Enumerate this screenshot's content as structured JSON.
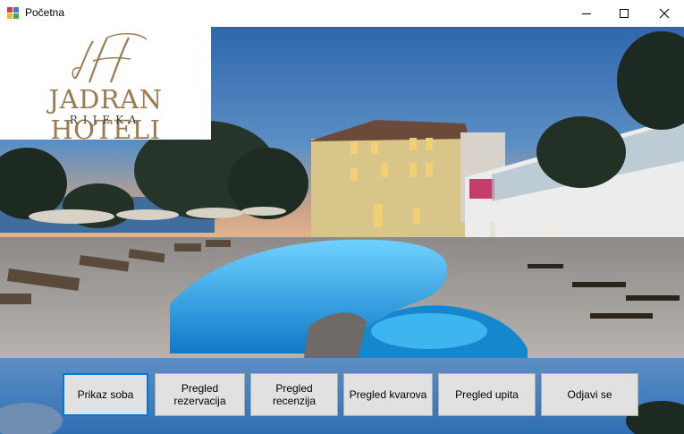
{
  "window": {
    "title": "Početna"
  },
  "logo": {
    "name": "JADRAN HOTELI",
    "city": "RIJEKA"
  },
  "buttons": {
    "prikaz_soba": "Prikaz soba",
    "pregled_rezervacija": "Pregled\nrezervacija",
    "pregled_recenzija": "Pregled recenzija",
    "pregled_kvarova": "Pregled kvarova",
    "pregled_upita": "Pregled upita",
    "odjavi_se": "Odjavi se"
  },
  "colors": {
    "brand_gold": "#9a7a4e",
    "focus_border": "#0078d7",
    "button_face": "#e1e1e1"
  },
  "icons": {
    "app": "form-icon",
    "minimize": "minimize-icon",
    "maximize": "maximize-icon",
    "close": "close-icon"
  }
}
